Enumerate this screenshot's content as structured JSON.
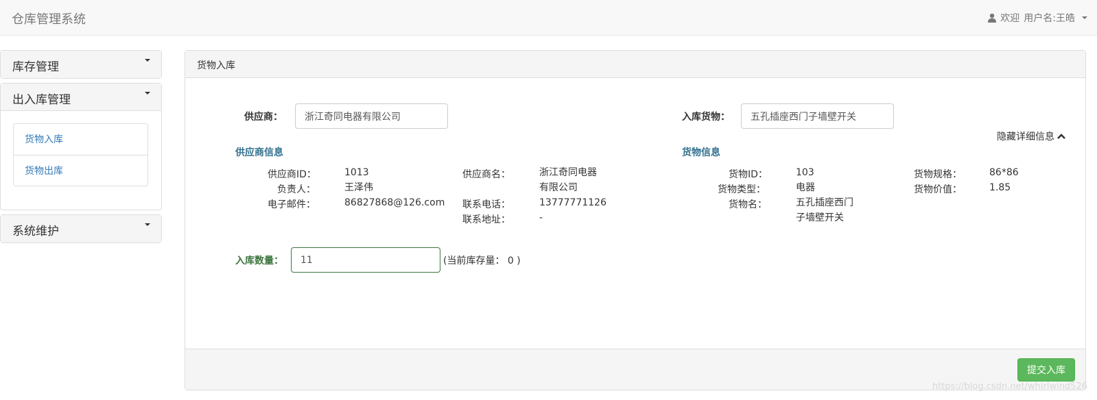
{
  "navbar": {
    "brand": "仓库管理系统",
    "welcome": "欢迎",
    "user_label": "用户名:王皓"
  },
  "sidebar": {
    "panels": [
      {
        "title": "库存管理"
      },
      {
        "title": "出入库管理",
        "items": [
          "货物入库",
          "货物出库"
        ]
      },
      {
        "title": "系统维护"
      }
    ]
  },
  "main": {
    "heading": "货物入库",
    "supplier_label": "供应商：",
    "supplier_value": "浙江奇同电器有限公司",
    "goods_label": "入库货物：",
    "goods_value": "五孔插座西门子墙壁开关",
    "toggle_label": "隐藏详细信息",
    "supplier_info": {
      "title": "供应商信息",
      "id_key": "供应商ID：",
      "id_val": "1013",
      "name_key": "供应商名：",
      "name_val_line1": "浙江奇同电器",
      "name_val_line2": "有限公司",
      "person_key": "负责人：",
      "person_val": "王泽伟",
      "email_key": "电子邮件：",
      "email_val": "86827868@126.com",
      "phone_key": "联系电话：",
      "phone_val": "13777771126",
      "address_key": "联系地址：",
      "address_val": "-"
    },
    "goods_info": {
      "title": "货物信息",
      "id_key": "货物ID：",
      "id_val": "103",
      "spec_key": "货物规格：",
      "spec_val": "86*86",
      "type_key": "货物类型：",
      "type_val": "电器",
      "price_key": "货物价值：",
      "price_val": "1.85",
      "name_key": "货物名：",
      "name_val_line1": "五孔插座西门",
      "name_val_line2": "子墙壁开关"
    },
    "quantity_label": "入库数量：",
    "quantity_value": "11",
    "stock_note": "(当前库存量： 0 )",
    "submit_label": "提交入库"
  },
  "watermark": "https://blog.csdn.net/whirlwind526"
}
